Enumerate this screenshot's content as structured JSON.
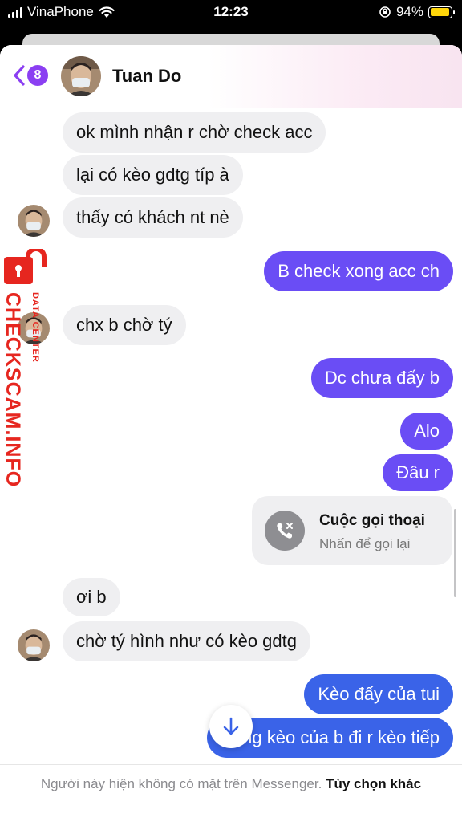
{
  "status_bar": {
    "carrier": "VinaPhone",
    "time": "12:23",
    "battery": "94%",
    "battery_level": 0.94
  },
  "header": {
    "badge_count": "8",
    "contact_name": "Tuan Do"
  },
  "messages": [
    {
      "dir": "in",
      "text": "ok mình nhận r chờ check acc"
    },
    {
      "dir": "in",
      "text": "lại có kèo gdtg típ à"
    },
    {
      "dir": "in",
      "text": "thấy có khách nt nè"
    },
    {
      "dir": "out",
      "text": "B check xong acc ch"
    },
    {
      "dir": "in",
      "text": "chx b chờ tý"
    },
    {
      "dir": "out",
      "text": "Dc chưa đấy b"
    },
    {
      "dir": "out",
      "text": "Alo"
    },
    {
      "dir": "out",
      "text": "Đâu r"
    },
    {
      "dir": "in",
      "text": "ơi b"
    },
    {
      "dir": "in",
      "text": "chờ tý hình như có kèo gdtg"
    },
    {
      "dir": "out",
      "text": "Kèo đấy của tui"
    },
    {
      "dir": "out",
      "text": "Xong kèo của b đi r kèo tiếp"
    }
  ],
  "call_card": {
    "title": "Cuộc gọi thoại",
    "subtitle": "Nhấn để gọi lại"
  },
  "footer": {
    "notice": "Người này hiện không có mặt trên Messenger.",
    "action": "Tùy chọn khác"
  },
  "watermark": {
    "brand": "CHECKSCAM.INFO",
    "tagline": "DATA CENTER"
  },
  "colors": {
    "outgoing_bubble": "#6a4df5",
    "outgoing_bubble_bottom": "#3a63e8",
    "incoming_bubble": "#efeff1",
    "badge": "#8b3ff2",
    "watermark": "#e6261f"
  }
}
